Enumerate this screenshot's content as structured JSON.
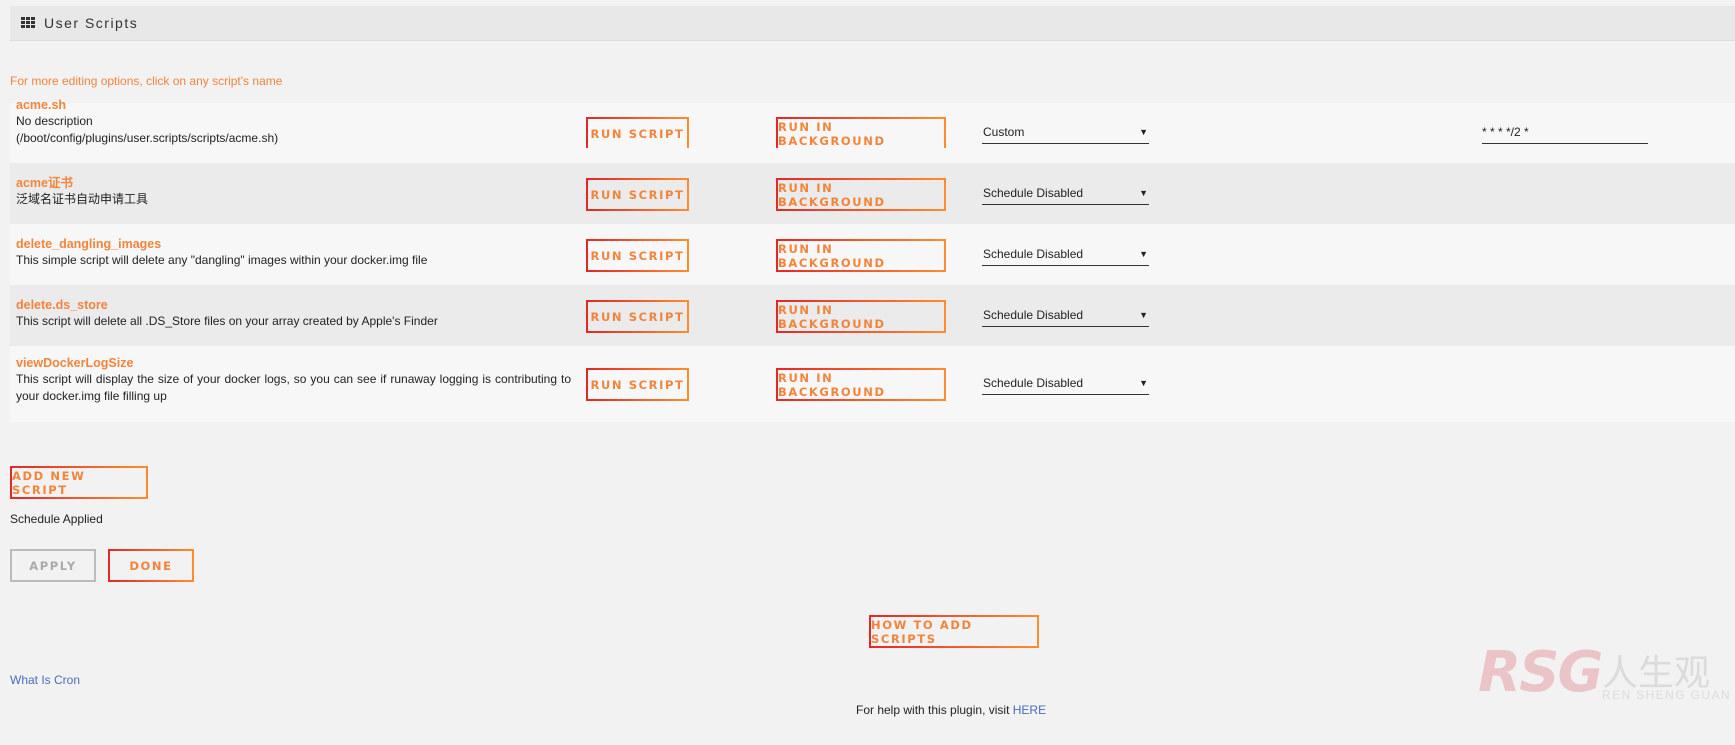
{
  "header": {
    "title": "User Scripts",
    "icon": "grid-icon"
  },
  "hint": "For more editing options, click on any script's name",
  "scripts": [
    {
      "name": "acme.sh",
      "description_lines": [
        "No description",
        "(/boot/config/plugins/user.scripts/scripts/acme.sh)"
      ],
      "run_label": "RUN SCRIPT",
      "background_label": "RUN IN BACKGROUND",
      "schedule": "Custom",
      "cron": "* * * */2 *"
    },
    {
      "name": "acme证书",
      "description_lines": [
        "泛域名证书自动申请工具"
      ],
      "run_label": "RUN SCRIPT",
      "background_label": "RUN IN BACKGROUND",
      "schedule": "Schedule Disabled"
    },
    {
      "name": "delete_dangling_images",
      "description_lines": [
        "This simple script will delete any \"dangling\" images within your docker.img file"
      ],
      "run_label": "RUN SCRIPT",
      "background_label": "RUN IN BACKGROUND",
      "schedule": "Schedule Disabled"
    },
    {
      "name": "delete.ds_store",
      "description_lines": [
        "This script will delete all .DS_Store files on your array created by Apple's Finder"
      ],
      "run_label": "RUN SCRIPT",
      "background_label": "RUN IN BACKGROUND",
      "schedule": "Schedule Disabled"
    },
    {
      "name": "viewDockerLogSize",
      "description_lines": [
        "This script will display the size of your docker logs, so you can see if runaway logging is contributing to your docker.img file filling up"
      ],
      "run_label": "RUN SCRIPT",
      "background_label": "RUN IN BACKGROUND",
      "schedule": "Schedule Disabled"
    }
  ],
  "actions": {
    "add_new": "ADD NEW SCRIPT",
    "status": "Schedule Applied",
    "apply": "APPLY",
    "done": "DONE",
    "how_to": "HOW TO ADD SCRIPTS"
  },
  "footer": {
    "what_is_cron": "What Is Cron",
    "help_text": "For help with this plugin, visit ",
    "help_link": "HERE"
  },
  "watermark": {
    "logo": "RSG",
    "cn": "人生观",
    "en": "REN SHENG GUAN"
  },
  "colors": {
    "accent": "#f2843b",
    "border_start": "#e22828",
    "border_end": "#ff8c2f",
    "link": "#486dba"
  }
}
